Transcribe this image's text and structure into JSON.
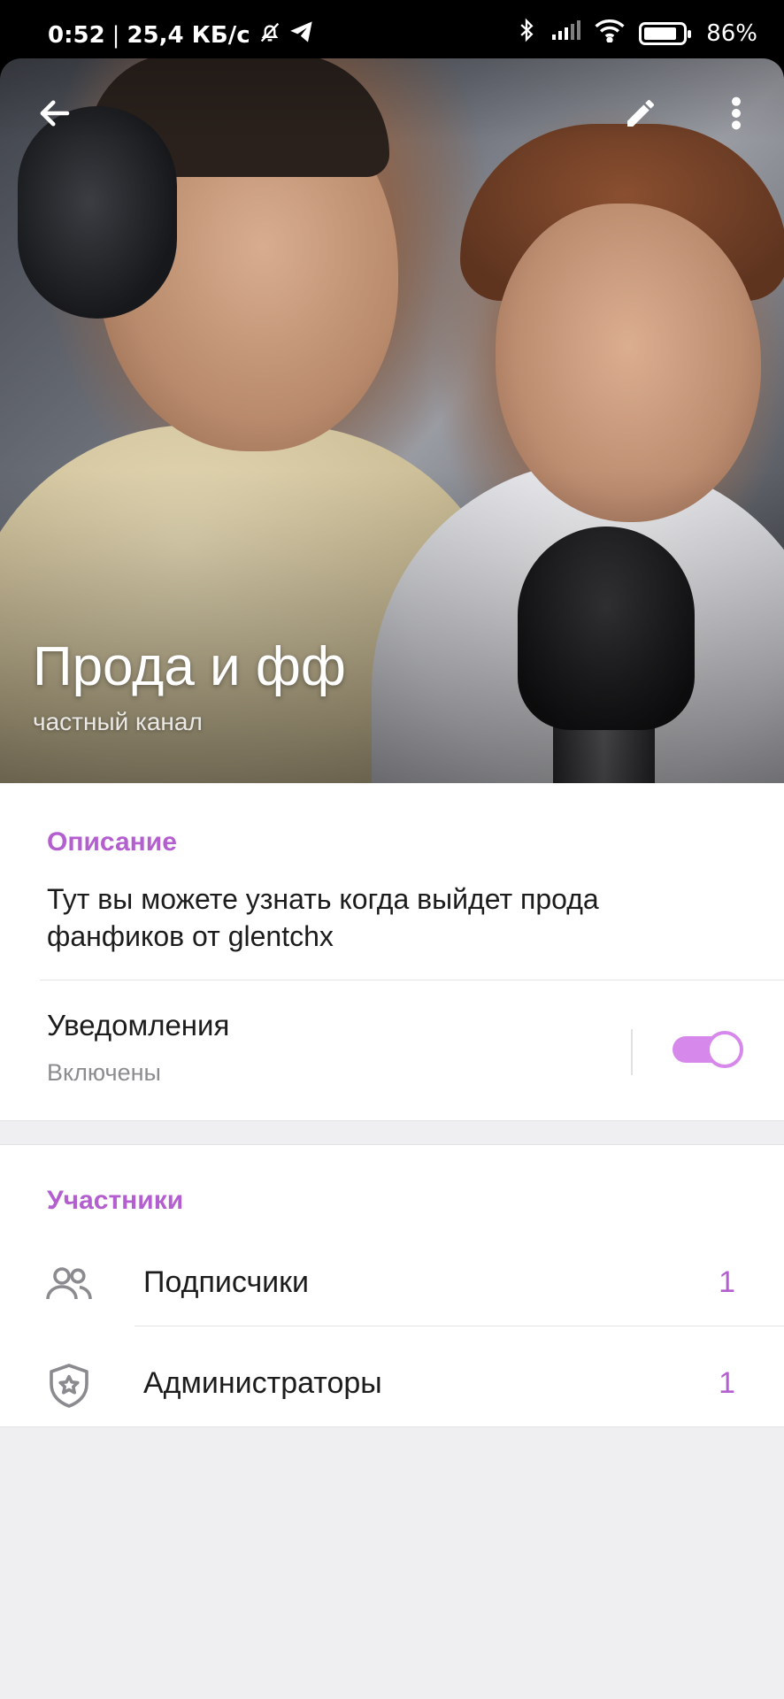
{
  "status_bar": {
    "time": "0:52",
    "separator": "|",
    "speed": "25,4 КБ/с",
    "battery": "86%",
    "battery_level": 0.86,
    "icons": [
      "mute-bell-icon",
      "telegram-icon",
      "bluetooth-icon",
      "signal-icon",
      "wifi-icon",
      "battery-icon"
    ]
  },
  "toolbar": {
    "back_icon": "arrow-left-icon",
    "edit_icon": "pencil-icon",
    "more_icon": "more-vertical-icon"
  },
  "channel": {
    "title": "Прода и фф",
    "subtitle": "частный канал"
  },
  "info": {
    "description_label": "Описание",
    "description_text": "Тут вы можете узнать когда выйдет прода фанфиков от glentchx",
    "notifications_label": "Уведомления",
    "notifications_state": "Включены",
    "notifications_on": true
  },
  "members": {
    "section_label": "Участники",
    "rows": [
      {
        "icon": "people-icon",
        "label": "Подписчики",
        "count": "1"
      },
      {
        "icon": "shield-star-icon",
        "label": "Администраторы",
        "count": "1"
      }
    ]
  },
  "colors": {
    "accent": "#b45fcf",
    "toggle": "#d689ea",
    "background": "#efeef1"
  }
}
